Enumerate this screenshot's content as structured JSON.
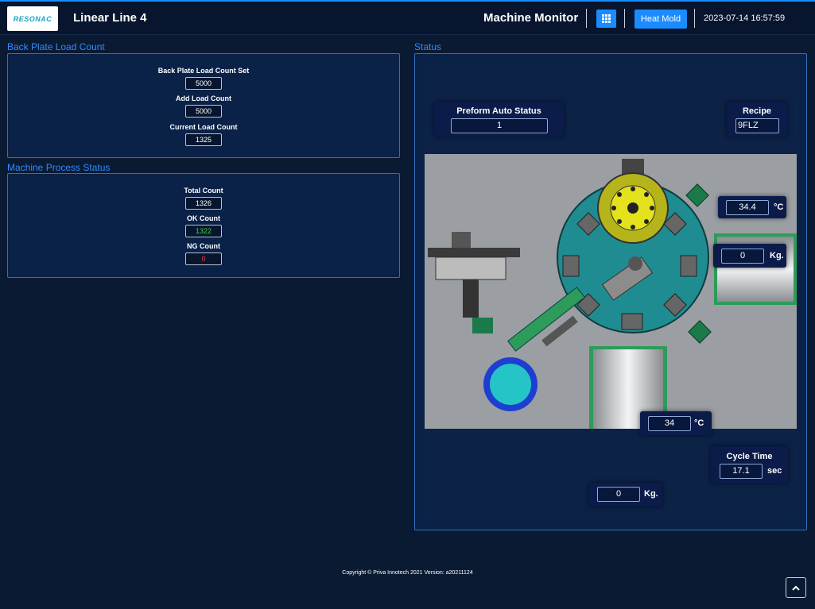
{
  "header": {
    "logo_text": "RESONAC",
    "app_title": "Linear Line 4",
    "page_title": "Machine Monitor",
    "heat_mold_label": "Heat Mold",
    "datetime": "2023-07-14 16:57:59",
    "accent_color": "#1a8cff"
  },
  "back_plate": {
    "section_title": "Back Plate Load Count",
    "set_label": "Back Plate Load Count Set",
    "set_value": "5000",
    "add_label": "Add Load Count",
    "add_value": "5000",
    "current_label": "Current Load Count",
    "current_value": "1325"
  },
  "process": {
    "section_title": "Machine Process Status",
    "total_label": "Total Count",
    "total_value": "1326",
    "ok_label": "OK Count",
    "ok_value": "1322",
    "ng_label": "NG Count",
    "ng_value": "0",
    "ok_color": "#3fd13f",
    "ng_color": "#ff3b3b"
  },
  "status": {
    "section_title": "Status",
    "preform_label": "Preform Auto Status",
    "preform_value": "1",
    "recipe_label": "Recipe",
    "recipe_value": "9FLZ",
    "temp_top_value": "34.4",
    "temp_top_unit": "°C",
    "weight_right_value": "0",
    "weight_right_unit": "Kg.",
    "temp_bottom_value": "34",
    "temp_bottom_unit": "°C",
    "cycle_label": "Cycle Time",
    "cycle_value": "17.1",
    "cycle_unit": "sec",
    "weight_bottom_value": "0",
    "weight_bottom_unit": "Kg."
  },
  "footer": {
    "copyright": "Copyright © Priva Innotech 2021 Version: a20211124"
  },
  "icons": {
    "grid": "grid-icon",
    "scroll_top": "chevron-up-icon"
  }
}
